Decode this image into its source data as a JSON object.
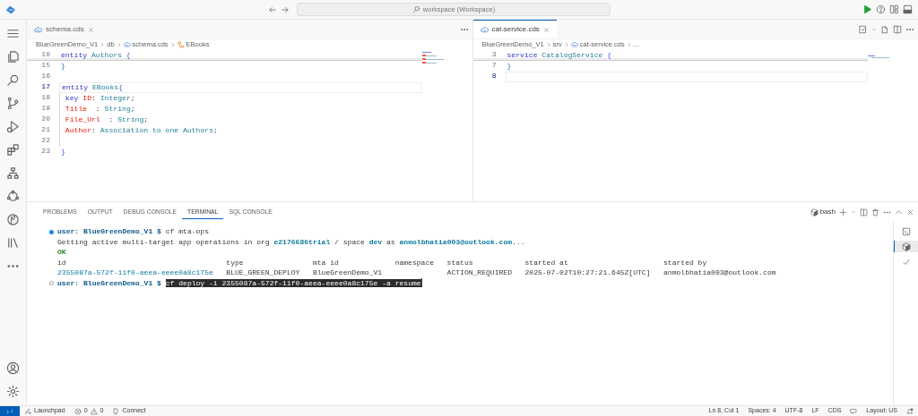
{
  "title_bar": {
    "search": "workspace (Workspace)"
  },
  "editors": [
    {
      "selected": false,
      "tab": "schema.cds",
      "breadcrumb": [
        {
          "text": "BlueGreenDemo_V1",
          "kind": "folder"
        },
        {
          "text": "db",
          "kind": "folder"
        },
        {
          "text": "schema.cds",
          "kind": "file"
        },
        {
          "text": "EBooks",
          "kind": "entity"
        }
      ],
      "lines": [
        {
          "number": "10",
          "sticky": true,
          "current": false,
          "guide": false,
          "tokens": [
            {
              "text": "entity ",
              "kind": "keyword"
            },
            {
              "text": "Authors ",
              "kind": "type"
            },
            {
              "text": "{",
              "kind": "brace"
            }
          ]
        },
        {
          "number": "15",
          "sticky": false,
          "current": false,
          "guide": false,
          "tokens": [
            {
              "text": "}",
              "kind": "brace"
            }
          ]
        },
        {
          "number": "16",
          "sticky": false,
          "current": false,
          "guide": false
        },
        {
          "number": "17",
          "sticky": false,
          "current": true,
          "guide": false,
          "tokens": [
            {
              "text": "entity ",
              "kind": "keyword"
            },
            {
              "text": "EBooks",
              "kind": "type"
            },
            {
              "text": "{",
              "kind": "brace"
            }
          ]
        },
        {
          "number": "18",
          "sticky": false,
          "current": false,
          "guide": true,
          "tokens": [
            {
              "text": " key ",
              "kind": "keyword"
            },
            {
              "text": "ID",
              "kind": "field"
            },
            {
              "text": ": ",
              "kind": "punct"
            },
            {
              "text": "Integer",
              "kind": "type"
            },
            {
              "text": ";",
              "kind": "punct"
            }
          ]
        },
        {
          "number": "19",
          "sticky": false,
          "current": false,
          "guide": true,
          "tokens": [
            {
              "text": " Title",
              "kind": "field"
            },
            {
              "text": "  : ",
              "kind": "punct"
            },
            {
              "text": "String",
              "kind": "type"
            },
            {
              "text": ";",
              "kind": "punct"
            }
          ]
        },
        {
          "number": "20",
          "sticky": false,
          "current": false,
          "guide": true,
          "tokens": [
            {
              "text": " File_Url",
              "kind": "field"
            },
            {
              "text": "  : ",
              "kind": "punct"
            },
            {
              "text": "String",
              "kind": "type"
            },
            {
              "text": ";",
              "kind": "punct"
            }
          ]
        },
        {
          "number": "21",
          "sticky": false,
          "current": false,
          "guide": true,
          "tokens": [
            {
              "text": " Author",
              "kind": "field"
            },
            {
              "text": ": ",
              "kind": "punct"
            },
            {
              "text": "Association to one Authors",
              "kind": "type"
            },
            {
              "text": ";",
              "kind": "punct"
            }
          ]
        },
        {
          "number": "22",
          "sticky": false,
          "current": false,
          "guide": true
        },
        {
          "number": "23",
          "sticky": false,
          "current": false,
          "guide": false,
          "tokens": [
            {
              "text": "}",
              "kind": "brace"
            }
          ]
        }
      ]
    },
    {
      "selected": true,
      "tab": "cat-service.cds",
      "breadcrumb": [
        {
          "text": "BlueGreenDemo_V1",
          "kind": "folder"
        },
        {
          "text": "srv",
          "kind": "folder"
        },
        {
          "text": "cat-service.cds",
          "kind": "file"
        },
        {
          "text": "...",
          "kind": "more"
        }
      ],
      "lines": [
        {
          "number": "3",
          "sticky": true,
          "current": false,
          "guide": false,
          "tokens": [
            {
              "text": "service ",
              "kind": "keyword"
            },
            {
              "text": "CatalogService ",
              "kind": "type"
            },
            {
              "text": "{",
              "kind": "brace"
            }
          ]
        },
        {
          "number": "7",
          "sticky": false,
          "current": false,
          "guide": false,
          "tokens": [
            {
              "text": "}",
              "kind": "brace"
            }
          ]
        },
        {
          "number": "8",
          "sticky": false,
          "current": true,
          "guide": false
        }
      ]
    }
  ],
  "panel": {
    "tabs": [
      {
        "label": "PROBLEMS",
        "selected": false
      },
      {
        "label": "OUTPUT",
        "selected": false
      },
      {
        "label": "DEBUG CONSOLE",
        "selected": false
      },
      {
        "label": "TERMINAL",
        "selected": true
      },
      {
        "label": "SQL CONSOLE",
        "selected": false
      }
    ],
    "profile": "bash",
    "terminals": [
      {
        "kind": "shell",
        "selected": false
      },
      {
        "kind": "bash",
        "selected": true
      },
      {
        "kind": "task",
        "selected": false
      }
    ],
    "lines": [
      {
        "kind": "prompt",
        "succeeded": true,
        "segments": [
          {
            "text": "user: BlueGreenDemo_V1 $",
            "kind": "prompt"
          },
          {
            "text": " cf mta-ops",
            "kind": "plain"
          }
        ]
      },
      {
        "kind": "text",
        "segments": [
          {
            "text": "Getting active multi-target app operations in org ",
            "kind": "plain"
          },
          {
            "text": "e2176686trial",
            "kind": "accent"
          },
          {
            "text": " / space ",
            "kind": "plain"
          },
          {
            "text": "dev",
            "kind": "accent"
          },
          {
            "text": " as ",
            "kind": "plain"
          },
          {
            "text": "anmolbhatia003@outlook.com",
            "kind": "accent"
          },
          {
            "text": "...",
            "kind": "plain"
          }
        ]
      },
      {
        "kind": "text",
        "segments": [
          {
            "text": "OK",
            "kind": "ok"
          }
        ]
      },
      {
        "kind": "table",
        "columns": [
          "id",
          "type",
          "mta id",
          "namespace",
          "status",
          "started at",
          "started by"
        ],
        "rows": [
          [
            "2355087a-572f-11f0-aeea-eeee0a8c175e",
            "BLUE_GREEN_DEPLOY",
            "BlueGreenDemo_V1",
            null,
            "ACTION_REQUIRED",
            "2025-07-02T10:27:21.645Z[UTC]",
            "anmolbhatia003@outlook.com"
          ]
        ]
      },
      {
        "kind": "prompt",
        "succeeded": false,
        "segments": [
          {
            "text": "user: BlueGreenDemo_V1 $",
            "kind": "prompt"
          },
          {
            "text": "cf deploy -i 2355087a-572f-11f0-aeea-eeee0a8c175e -a resume",
            "kind": "selected"
          }
        ]
      }
    ]
  },
  "status_bar": {
    "left": [
      {
        "kind": "remote"
      },
      {
        "kind": "launchpad",
        "text": "Launchpad"
      },
      {
        "kind": "problems",
        "errors": "0",
        "warnings": "0"
      },
      {
        "kind": "connect",
        "text": "Connect"
      }
    ],
    "right": [
      {
        "kind": "text",
        "text": "Ln 8, Col 1"
      },
      {
        "kind": "text",
        "text": "Spaces: 4"
      },
      {
        "kind": "text",
        "text": "UTF-8"
      },
      {
        "kind": "text",
        "text": "LF"
      },
      {
        "kind": "text",
        "text": "CDS"
      },
      {
        "kind": "feedback"
      },
      {
        "kind": "text",
        "text": "Layout: US"
      },
      {
        "kind": "bell"
      }
    ]
  }
}
